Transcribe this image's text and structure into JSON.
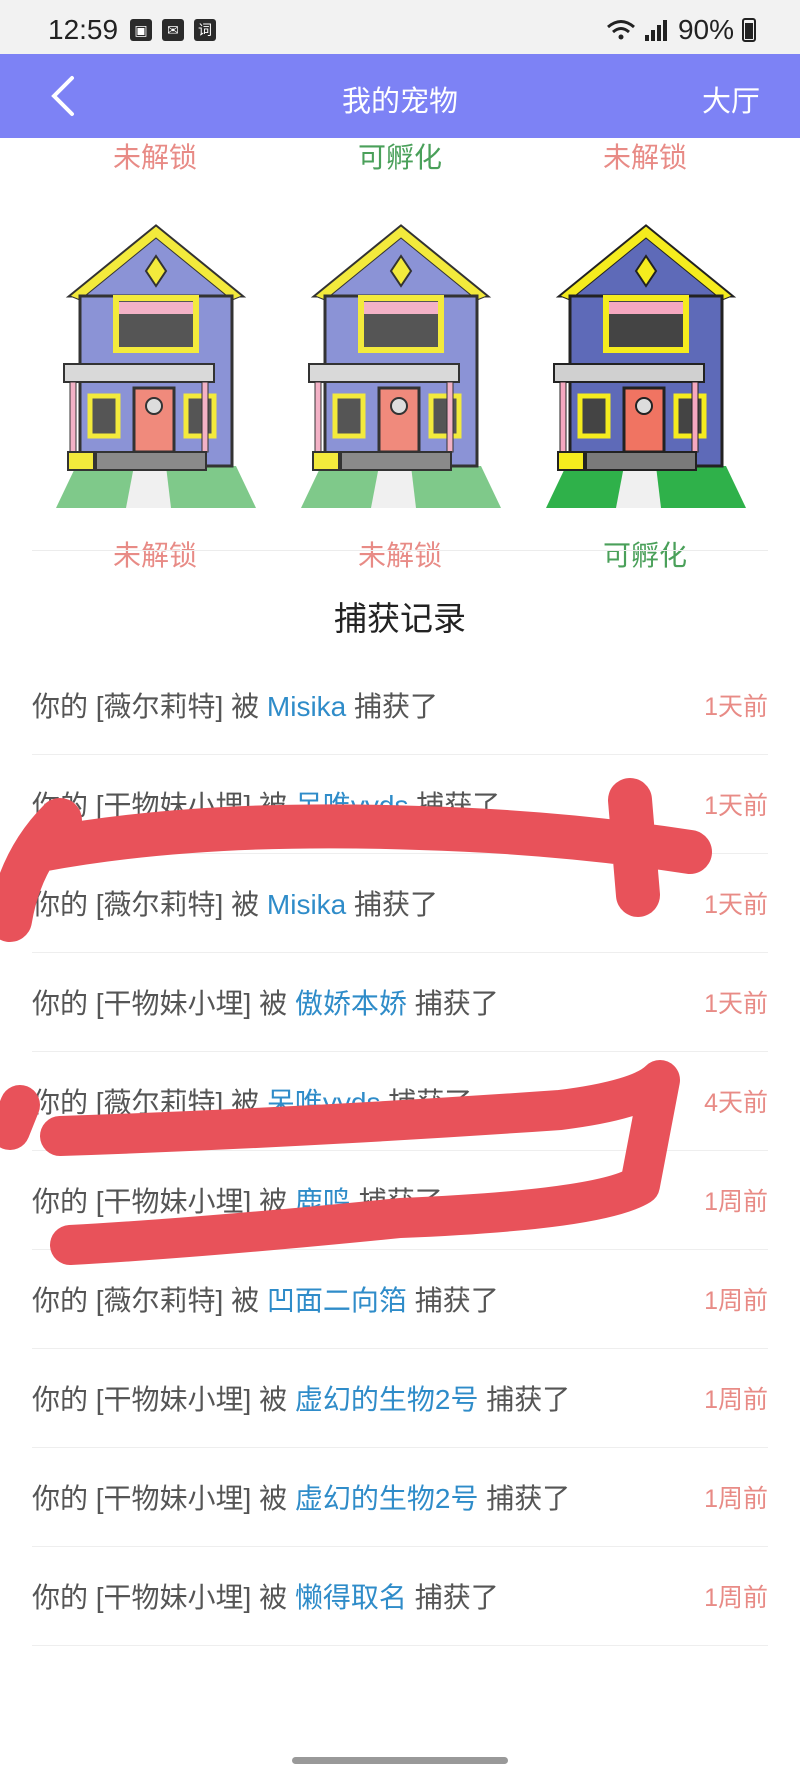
{
  "status_bar": {
    "time": "12:59",
    "icons_left": [
      "image-icon",
      "mail-icon",
      "dict-icon"
    ],
    "dict_glyph": "词",
    "battery": "90%"
  },
  "app_bar": {
    "title": "我的宠物",
    "back_icon": "chevron-left-icon",
    "right_label": "大厅"
  },
  "pets": [
    {
      "top_status": "未解锁",
      "bottom_status": "未解锁"
    },
    {
      "top_status": "可孵化",
      "bottom_status": "未解锁"
    },
    {
      "top_status": "未解锁",
      "bottom_status": "可孵化"
    }
  ],
  "records": {
    "title": "捕获记录",
    "items": [
      {
        "prefix": "你的 [薇尔莉特] 被",
        "catcher": "Misika",
        "suffix": "捕获了",
        "time": "1天前"
      },
      {
        "prefix": "你的 [干物妹小埋] 被",
        "catcher": "呆唯yyds",
        "suffix": "捕获了",
        "time": "1天前"
      },
      {
        "prefix": "你的 [薇尔莉特] 被",
        "catcher": "Misika",
        "suffix": "捕获了",
        "time": "1天前"
      },
      {
        "prefix": "你的 [干物妹小埋] 被",
        "catcher": "傲娇本娇",
        "suffix": "捕获了",
        "time": "1天前"
      },
      {
        "prefix": "你的 [薇尔莉特] 被",
        "catcher": "呆唯yyds",
        "suffix": "捕获了",
        "time": "4天前"
      },
      {
        "prefix": "你的 [干物妹小埋] 被",
        "catcher": "鹿鸣",
        "suffix": "捕获了",
        "time": "1周前"
      },
      {
        "prefix": "你的 [薇尔莉特] 被",
        "catcher": "凹面二向箔",
        "suffix": "捕获了",
        "time": "1周前"
      },
      {
        "prefix": "你的 [干物妹小埋] 被",
        "catcher": "虚幻的生物2号",
        "suffix": "捕获了",
        "time": "1周前"
      },
      {
        "prefix": "你的 [干物妹小埋] 被",
        "catcher": "虚幻的生物2号",
        "suffix": "捕获了",
        "time": "1周前"
      },
      {
        "prefix": "你的 [干物妹小埋] 被",
        "catcher": "懒得取名",
        "suffix": "捕获了",
        "time": "1周前"
      }
    ]
  },
  "colors": {
    "app_bar": "#7d82f5",
    "locked": "#e88b86",
    "hatchable": "#4aa05a",
    "catcher": "#2f8cc9",
    "scribble": "#e8525a"
  }
}
